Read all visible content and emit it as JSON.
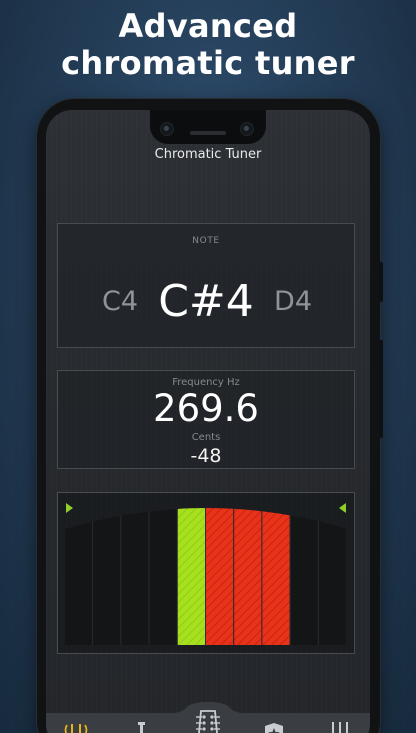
{
  "headline": {
    "line1": "Advanced",
    "line2": "chromatic tuner"
  },
  "app": {
    "title": "Chromatic Tuner"
  },
  "note_panel": {
    "label": "NOTE",
    "previous": "C4",
    "current": "C#4",
    "next": "D4"
  },
  "frequency_panel": {
    "frequency_label": "Frequency Hz",
    "frequency_value": "269.6",
    "cents_label": "Cents",
    "cents_value": "-48"
  },
  "meter": {
    "segment_count": 10,
    "active_green_segment": 4,
    "red_segments": [
      5,
      6,
      7
    ],
    "colors": {
      "green": "#a6e01e",
      "red": "#e8321a",
      "marker": "#8fcf2a",
      "dark": "#141517"
    }
  },
  "tabs": [
    {
      "icon": "tuning-fork-icon",
      "active": true
    },
    {
      "icon": "guitar-gamepad-icon",
      "active": false
    },
    {
      "icon": "guitar-headstock-icon",
      "active": false
    },
    {
      "icon": "shield-star-icon",
      "active": false
    },
    {
      "icon": "multiple-guitars-icon",
      "active": false
    }
  ],
  "colors": {
    "accent": "#e7b21a",
    "background": "#223a53"
  }
}
